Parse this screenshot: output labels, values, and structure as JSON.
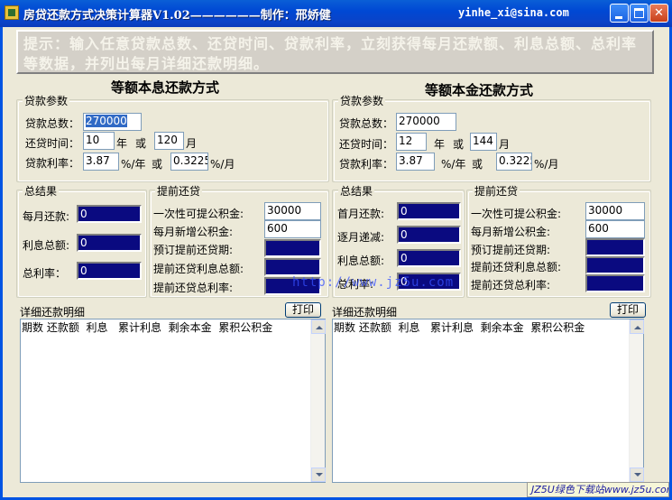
{
  "window": {
    "title": "房贷还款方式决策计算器V1.02——————制作：邢娇健",
    "email": "yinhe_xi@sina.com",
    "minimize_label": "",
    "maximize_label": "",
    "close_label": "✕"
  },
  "hint": "提示：输入任意贷款总数、还贷时间、贷款利率，立刻获得每月还款额、利息总额、总利率等数据，并列出每月详细还款明细。",
  "left": {
    "heading": "等额本息还款方式",
    "params": {
      "caption": "贷款参数",
      "principal_label": "贷款总数：",
      "principal_value": "270000",
      "term_label": "还贷时间：",
      "years_value": "10",
      "years_unit": "年",
      "or_1": "或",
      "months_value": "120",
      "months_unit": "月",
      "rate_label": "贷款利率：",
      "annual_rate_value": "3.87",
      "annual_rate_unit": "%/年",
      "or_2": "或",
      "monthly_rate_value": "0.3225",
      "monthly_rate_unit": "%/月"
    },
    "summary": {
      "caption": "总结果",
      "monthly_payment_label": "每月还款:",
      "monthly_payment_value": "0",
      "total_interest_label": "利息总额:",
      "total_interest_value": "0",
      "total_rate_label": "总利率：",
      "total_rate_value": "0"
    },
    "prepay": {
      "caption": "提前还贷",
      "lump_label": "一次性可提公积金:",
      "lump_value": "30000",
      "monthly_add_label": "每月新增公积金:",
      "monthly_add_value": "600",
      "expected_period_label": "预订提前还贷期:",
      "interest_total_label": "提前还贷利息总额:",
      "total_rate_label": "提前还贷总利率:"
    },
    "detail": {
      "caption": "详细还款明细",
      "print_label": "打印",
      "columns": [
        "期数",
        "还款额",
        "利息",
        "累计利息",
        "剩余本金",
        "累积公积金"
      ]
    }
  },
  "right": {
    "heading": "等额本金还款方式",
    "params": {
      "caption": "贷款参数",
      "principal_label": "贷款总数：",
      "principal_value": "270000",
      "term_label": "还贷时间：",
      "years_value": "12",
      "years_unit": "年",
      "or_1": "或",
      "months_value": "144",
      "months_unit": "月",
      "rate_label": "贷款利率：",
      "annual_rate_value": "3.87",
      "annual_rate_unit": "%/年",
      "or_2": "或",
      "monthly_rate_value": "0.3225",
      "monthly_rate_unit": "%/月"
    },
    "summary": {
      "caption": "总结果",
      "first_payment_label": "首月还款:",
      "first_payment_value": "0",
      "monthly_decrease_label": "逐月递减:",
      "monthly_decrease_value": "0",
      "total_interest_label": "利息总额:",
      "total_interest_value": "0",
      "total_rate_label": "总利率:",
      "total_rate_value": "0"
    },
    "prepay": {
      "caption": "提前还贷",
      "lump_label": "一次性可提公积金:",
      "lump_value": "30000",
      "monthly_add_label": "每月新增公积金:",
      "monthly_add_value": "600",
      "expected_period_label": "预订提前还贷期:",
      "interest_total_label": "提前还贷利息总额:",
      "total_rate_label": "提前还贷总利率:"
    },
    "detail": {
      "caption": "详细还款明细",
      "print_label": "打印",
      "columns": [
        "期数",
        "还款额",
        "利息",
        "累计利息",
        "剩余本金",
        "累积公积金"
      ]
    }
  },
  "watermark": "http://www.jz5u.com",
  "corner_badge": "JZ5U绿色下载站www.jz5u.com"
}
